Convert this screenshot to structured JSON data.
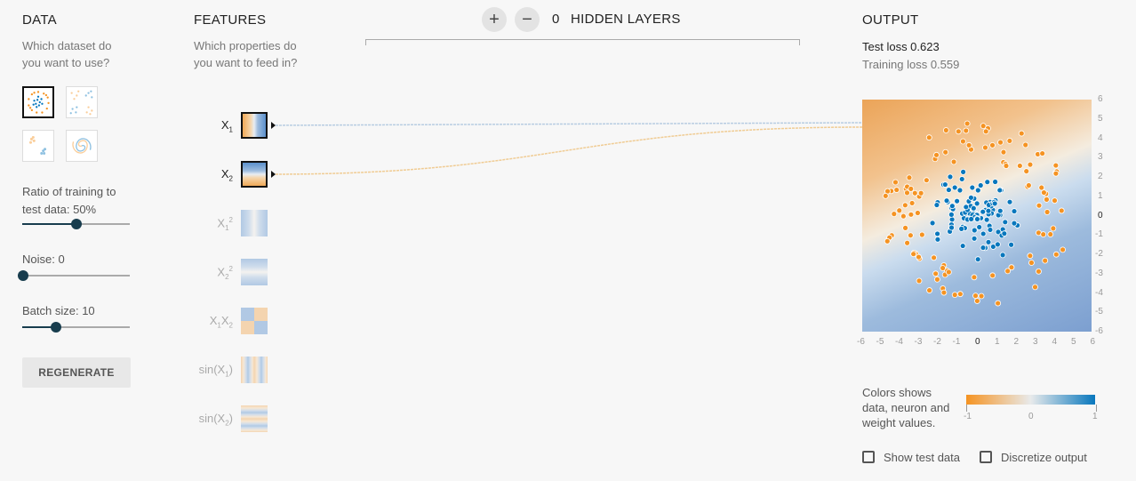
{
  "data_section": {
    "title": "DATA",
    "question": [
      "Which dataset do",
      "you want to use?"
    ],
    "datasets": [
      {
        "name": "circle",
        "selected": true
      },
      {
        "name": "xor",
        "selected": false
      },
      {
        "name": "gaussian",
        "selected": false
      },
      {
        "name": "spiral",
        "selected": false
      }
    ],
    "ratio_label_line1": "Ratio of training to",
    "ratio_label_line2": "test data:  50%",
    "ratio_value": 0.5,
    "noise_label": "Noise:  0",
    "noise_value": 0,
    "batch_label": "Batch size:  10",
    "batch_value": 0.3,
    "regenerate_label": "REGENERATE"
  },
  "features_section": {
    "title": "FEATURES",
    "question": [
      "Which properties do",
      "you want to feed in?"
    ],
    "items": [
      {
        "id": "x1",
        "label_main": "X",
        "label_sub": "1",
        "active": true
      },
      {
        "id": "x2",
        "label_main": "X",
        "label_sub": "2",
        "active": true
      },
      {
        "id": "x1sq",
        "label_main": "X",
        "label_sub": "1",
        "label_sup": "2",
        "active": false
      },
      {
        "id": "x2sq",
        "label_main": "X",
        "label_sub": "2",
        "label_sup": "2",
        "active": false
      },
      {
        "id": "x1x2",
        "label_main": "X",
        "label_sub": "1",
        "label_main2": "X",
        "label_sub2": "2",
        "active": false
      },
      {
        "id": "sinx1",
        "label_main": "sin(X",
        "label_sub": "1",
        "label_end": ")",
        "active": false
      },
      {
        "id": "sinx2",
        "label_main": "sin(X",
        "label_sub": "2",
        "label_end": ")",
        "active": false
      }
    ]
  },
  "hidden_layers": {
    "plus_label": "+",
    "minus_label": "−",
    "count": "0",
    "label": "HIDDEN LAYERS"
  },
  "output_section": {
    "title": "OUTPUT",
    "test_loss": "Test loss 0.623",
    "training_loss": "Training loss 0.559",
    "y_ticks": [
      "6",
      "5",
      "4",
      "3",
      "2",
      "1",
      "0",
      "-1",
      "-2",
      "-3",
      "-4",
      "-5",
      "-6"
    ],
    "x_ticks": [
      "-6",
      "-5",
      "-4",
      "-3",
      "-2",
      "-1",
      "0",
      "1",
      "2",
      "3",
      "4",
      "5",
      "6"
    ],
    "colors_text": [
      "Colors shows",
      "data, neuron and",
      "weight values."
    ],
    "legend_ticks": [
      "-1",
      "0",
      "1"
    ],
    "show_test_label": "Show test data",
    "discretize_label": "Discretize output"
  },
  "colors": {
    "orange": "#f59322",
    "blue": "#0877bd",
    "accent_dark": "#183d4e"
  }
}
